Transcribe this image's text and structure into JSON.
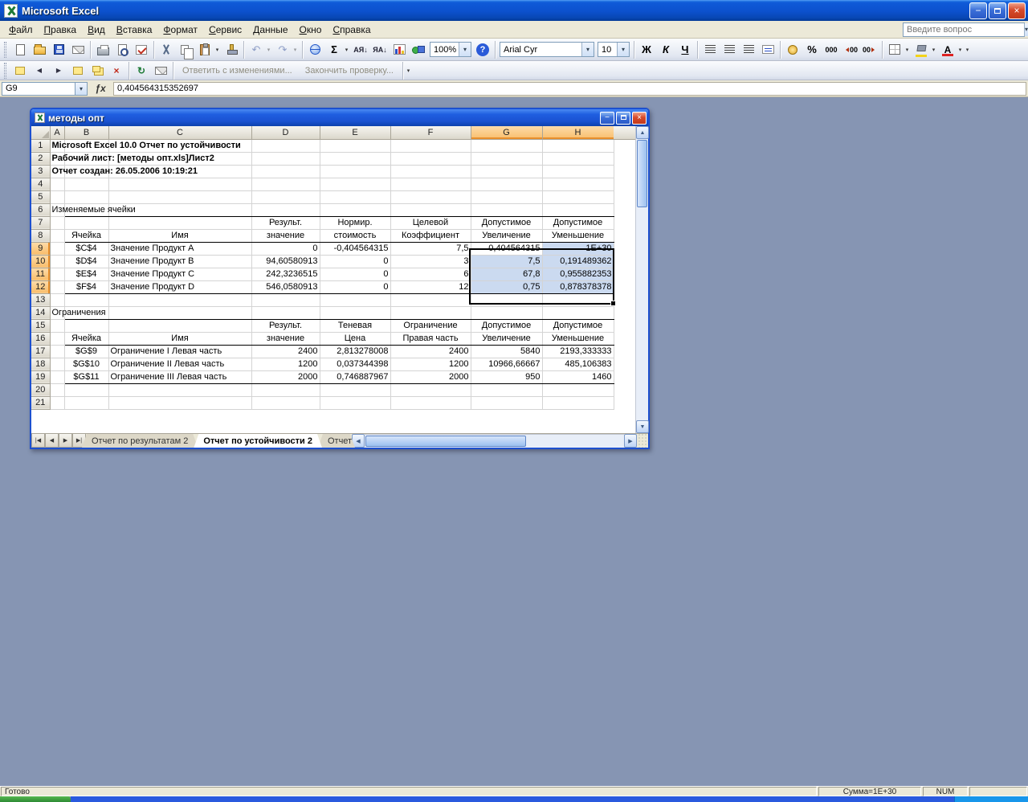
{
  "window": {
    "title": "Microsoft Excel"
  },
  "menu": {
    "items": [
      "Файл",
      "Правка",
      "Вид",
      "Вставка",
      "Формат",
      "Сервис",
      "Данные",
      "Окно",
      "Справка"
    ],
    "question_placeholder": "Введите вопрос"
  },
  "glyphs": {
    "minimize": "−",
    "close": "×",
    "dropdown": "▾",
    "up": "▲",
    "down": "▼",
    "left": "◀",
    "right": "▶",
    "tab_first": "|◀",
    "tab_last": "▶|",
    "undo": "↶",
    "redo": "↷",
    "refresh": "↻",
    "delete": "×",
    "fx": "ƒx"
  },
  "toolbar": {
    "zoom": "100%",
    "autosum": "Σ",
    "sort_asc": "АЯ↓",
    "sort_desc": "ЯА↓",
    "help": "?",
    "font_name": "Arial Cyr",
    "font_size": "10",
    "bold": "Ж",
    "italic": "К",
    "underline": "Ч",
    "percent": "%",
    "thousands": "000",
    "decimals": "00",
    "font_color_letter": "А"
  },
  "review": {
    "reply": "Ответить с изменениями...",
    "finish": "Закончить проверку..."
  },
  "formula_bar": {
    "name_box": "G9",
    "value": "0,404564315352697"
  },
  "workbook": {
    "title": "методы опт",
    "col_headers": [
      "A",
      "B",
      "C",
      "D",
      "E",
      "F",
      "G",
      "H"
    ],
    "row_numbers": [
      "1",
      "2",
      "3",
      "4",
      "5",
      "6",
      "7",
      "8",
      "9",
      "10",
      "11",
      "12",
      "13",
      "14",
      "15",
      "16",
      "17",
      "18",
      "19",
      "20",
      "21"
    ],
    "tabs": [
      "Отчет по результатам 2",
      "Отчет по устойчивости 2",
      "Отчет"
    ]
  },
  "report": {
    "line1": "Microsoft Excel 10.0 Отчет по устойчивости",
    "line2": "Рабочий лист: [методы опт.xls]Лист2",
    "line3": "Отчет создан: 26.05.2006 10:19:21",
    "vars": {
      "title": "Изменяемые ячейки",
      "h1": [
        "Результ.",
        "Нормир.",
        "Целевой",
        "Допустимое",
        "Допустимое"
      ],
      "h2": [
        "Ячейка",
        "Имя",
        "значение",
        "стоимость",
        "Коэффициент",
        "Увеличение",
        "Уменьшение"
      ],
      "rows": [
        [
          "$C$4",
          "Значение Продукт A",
          "0",
          "-0,404564315",
          "7,5",
          "0,404564315",
          "1E+30"
        ],
        [
          "$D$4",
          "Значение Продукт B",
          "94,60580913",
          "0",
          "3",
          "7,5",
          "0,191489362"
        ],
        [
          "$E$4",
          "Значение Продукт C",
          "242,3236515",
          "0",
          "6",
          "67,8",
          "0,955882353"
        ],
        [
          "$F$4",
          "Значение Продукт D",
          "546,0580913",
          "0",
          "12",
          "0,75",
          "0,878378378"
        ]
      ]
    },
    "cons": {
      "title": "Ограничения",
      "h1": [
        "Результ.",
        "Теневая",
        "Ограничение",
        "Допустимое",
        "Допустимое"
      ],
      "h2": [
        "Ячейка",
        "Имя",
        "значение",
        "Цена",
        "Правая часть",
        "Увеличение",
        "Уменьшение"
      ],
      "rows": [
        [
          "$G$9",
          "Ограничение I Левая часть",
          "2400",
          "2,813278008",
          "2400",
          "5840",
          "2193,333333"
        ],
        [
          "$G$10",
          "Ограничение II Левая часть",
          "1200",
          "0,037344398",
          "1200",
          "10966,66667",
          "485,106383"
        ],
        [
          "$G$11",
          "Ограничение III Левая часть",
          "2000",
          "0,746887967",
          "2000",
          "950",
          "1460"
        ]
      ]
    }
  },
  "status": {
    "ready": "Готово",
    "sum": "Сумма=1E+30",
    "num": "NUM"
  }
}
